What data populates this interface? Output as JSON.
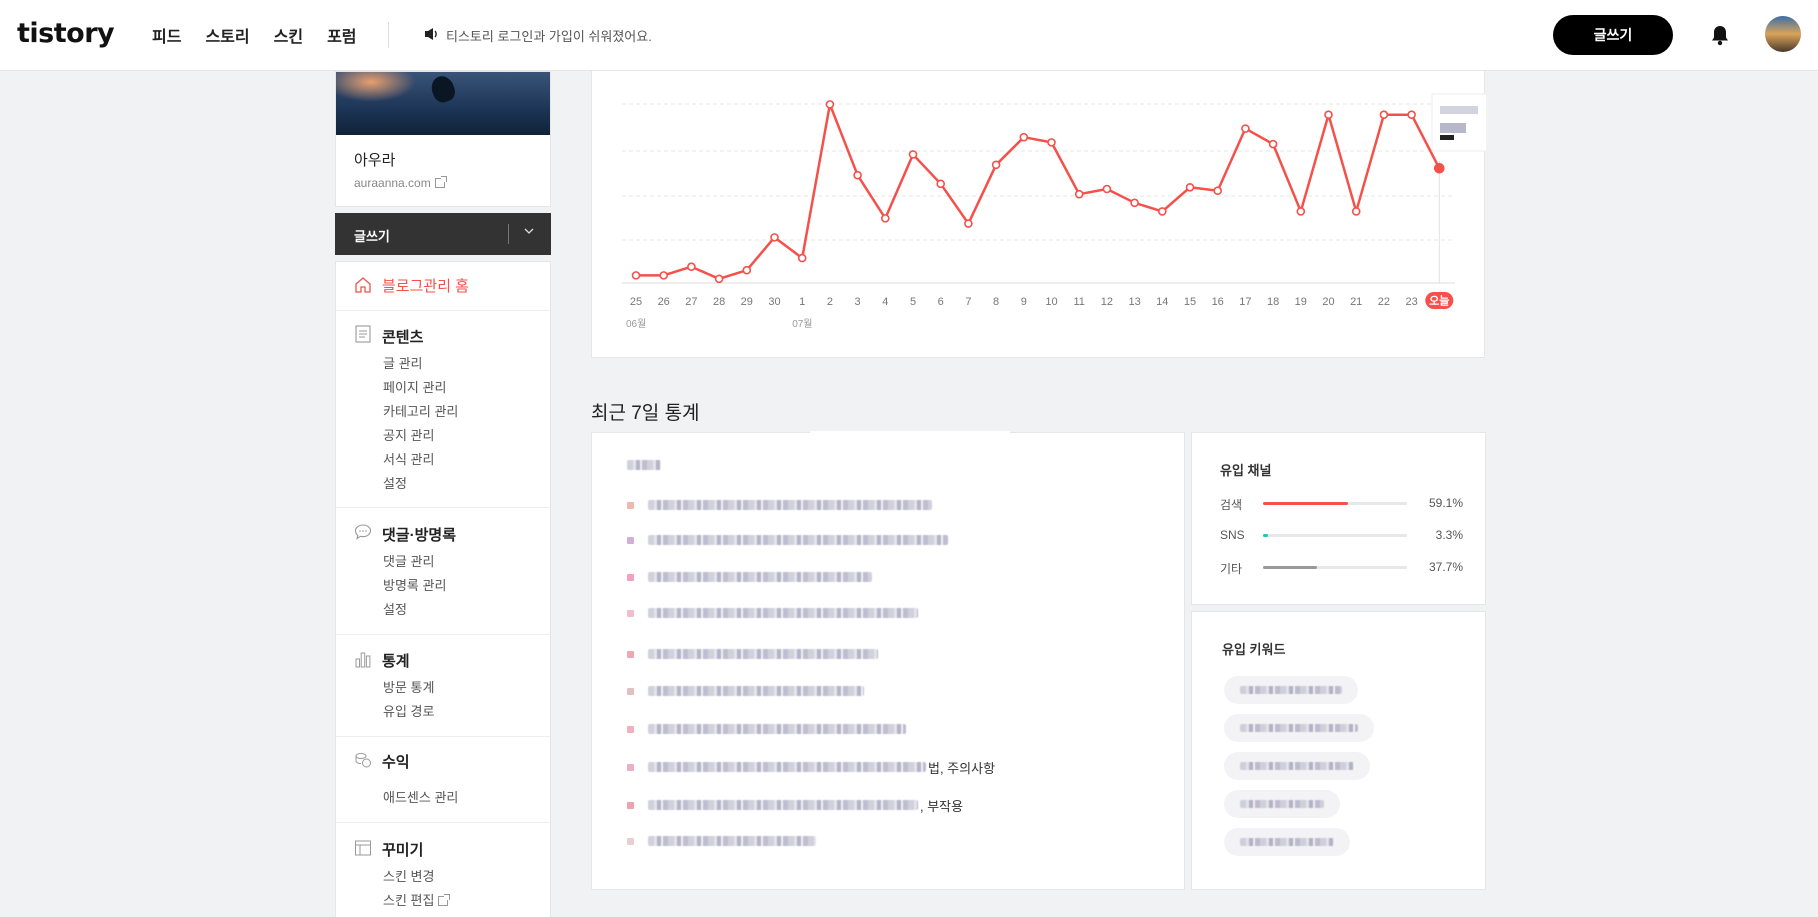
{
  "header": {
    "logo": "tistory",
    "nav": [
      "피드",
      "스토리",
      "스킨",
      "포럼"
    ],
    "notice": "티스토리 로그인과 가입이 쉬워졌어요.",
    "write_button": "글쓰기"
  },
  "sidebar": {
    "blog_name": "아우라",
    "blog_url": "auraanna.com",
    "write_button": "글쓰기",
    "home": "블로그관리 홈",
    "sections": [
      {
        "title": "콘텐츠",
        "icon": "document-icon",
        "items": [
          "글 관리",
          "페이지 관리",
          "카테고리 관리",
          "공지 관리",
          "서식 관리",
          "설정"
        ]
      },
      {
        "title": "댓글·방명록",
        "icon": "comment-icon",
        "items": [
          "댓글 관리",
          "방명록 관리",
          "설정"
        ]
      },
      {
        "title": "통계",
        "icon": "bar-chart-icon",
        "items": [
          "방문 통계",
          "유입 경로"
        ]
      },
      {
        "title": "수익",
        "icon": "coins-icon",
        "items": [
          "애드센스 관리"
        ]
      },
      {
        "title": "꾸미기",
        "icon": "layout-icon",
        "items": [
          "스킨 변경",
          "스킨 편집"
        ]
      }
    ]
  },
  "chart_data": {
    "type": "line",
    "x": [
      "25",
      "26",
      "27",
      "28",
      "29",
      "30",
      "1",
      "2",
      "3",
      "4",
      "5",
      "6",
      "7",
      "8",
      "9",
      "10",
      "11",
      "12",
      "13",
      "14",
      "15",
      "16",
      "17",
      "18",
      "19",
      "20",
      "21",
      "22",
      "23",
      "오늘"
    ],
    "month_labels": [
      {
        "index": 0,
        "label": "06월"
      },
      {
        "index": 6,
        "label": "07월"
      }
    ],
    "values": [
      5,
      5,
      10,
      3,
      8,
      27,
      15,
      104,
      63,
      38,
      75,
      58,
      35,
      69,
      85,
      82,
      52,
      55,
      47,
      42,
      56,
      54,
      90,
      81,
      42,
      98,
      42,
      98,
      98,
      67
    ],
    "ylim": [
      0,
      110
    ],
    "grid": true,
    "color": "#f5504a"
  },
  "recent": {
    "title": "최근 7일 통계",
    "post_suffixes": [
      "",
      "",
      "",
      "",
      "",
      "",
      "",
      "법, 주의사항",
      ", 부작용",
      ""
    ]
  },
  "channels": {
    "title": "유입 채널",
    "items": [
      {
        "label": "검색",
        "value": "59.1%",
        "ratio": 0.591,
        "color": "#f5504a"
      },
      {
        "label": "SNS",
        "value": "3.3%",
        "ratio": 0.033,
        "color": "#1bc9b3"
      },
      {
        "label": "기타",
        "value": "37.7%",
        "ratio": 0.377,
        "color": "#999999"
      }
    ]
  },
  "keywords": {
    "title": "유입 키워드"
  }
}
